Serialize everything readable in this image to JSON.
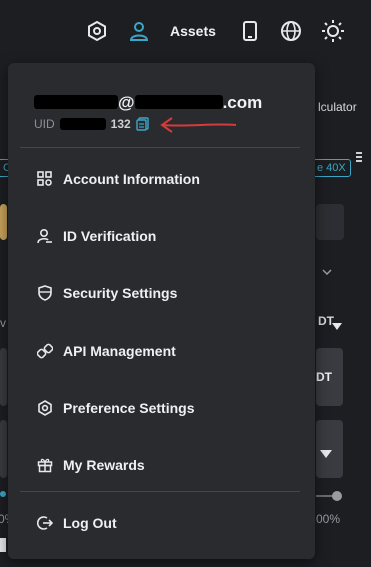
{
  "header": {
    "assets_label": "Assets",
    "icons": [
      "hexagon-settings-icon",
      "user-icon",
      "mobile-icon",
      "globe-icon",
      "sun-icon"
    ]
  },
  "background": {
    "calculator_fragment": "lculator",
    "leverage_chip": "e 40X",
    "left_chip": "C",
    "dt_label": "DT",
    "percent_label": "00%",
    "left_pct": "0%",
    "v_label": "v"
  },
  "account": {
    "email_visible_part": "@",
    "email_domain_suffix": ".com",
    "uid_label": "UID",
    "uid_visible_suffix": "132"
  },
  "menu": {
    "items": [
      {
        "label": "Account Information",
        "icon": "grid-settings-icon"
      },
      {
        "label": "ID Verification",
        "icon": "user-check-icon"
      },
      {
        "label": "Security Settings",
        "icon": "shield-icon"
      },
      {
        "label": "API Management",
        "icon": "link-icon"
      },
      {
        "label": "Preference Settings",
        "icon": "hexagon-icon"
      },
      {
        "label": "My Rewards",
        "icon": "gift-icon"
      }
    ],
    "logout_label": "Log Out"
  },
  "colors": {
    "accent": "#3aa7c8",
    "annotation_arrow": "#d63a3a",
    "panel": "#2a2b2f",
    "page_bg": "#1d1e22"
  }
}
